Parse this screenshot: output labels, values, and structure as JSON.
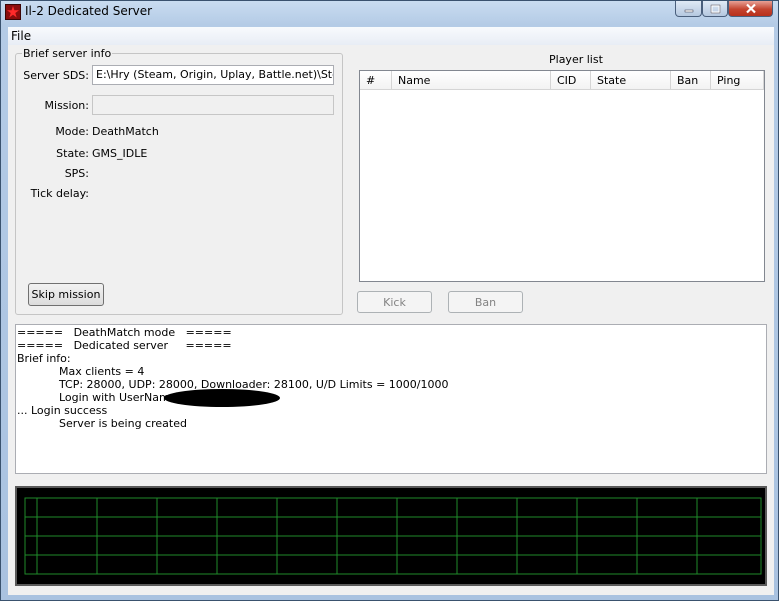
{
  "window": {
    "title": "Il-2 Dedicated Server",
    "icons": {
      "app": "red-star-icon",
      "minimize": "minimize-icon",
      "maximize": "maximize-icon",
      "close": "close-icon"
    }
  },
  "menu": {
    "file": "File"
  },
  "brief_info": {
    "legend": "Brief server info",
    "server_sds_label": "Server SDS:",
    "server_sds_value": "E:\\Hry (Steam, Origin, Uplay, Battle.net)\\Steam\\",
    "mission_label": "Mission:",
    "mission_value": "",
    "mode_label": "Mode:",
    "mode_value": "DeathMatch",
    "state_label": "State:",
    "state_value": "GMS_IDLE",
    "sps_label": "SPS:",
    "tick_delay_label": "Tick delay:",
    "skip_button": "Skip mission"
  },
  "player_list": {
    "title": "Player list",
    "columns": [
      "#",
      "Name",
      "CID",
      "State",
      "Ban",
      "Ping"
    ],
    "kick_button": "Kick",
    "ban_button": "Ban"
  },
  "log": {
    "lines": [
      "=====   DeathMatch mode   =====",
      "=====   Dedicated server     =====",
      "Brief info:",
      "            Max clients = 4",
      "            TCP: 28000, UDP: 28000, Downloader: 28100, U/D Limits = 1000/1000",
      "            Login with UserName",
      "... Login success",
      "            Server is being created"
    ]
  },
  "colors": {
    "graph_background": "#000000",
    "graph_grid": "#1f8a2a",
    "close_button": "#c4442f"
  }
}
